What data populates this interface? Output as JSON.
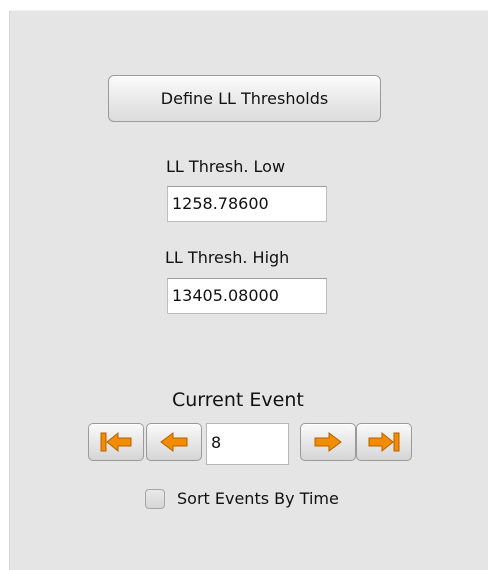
{
  "thresholds": {
    "define_button_label": "Define LL Thresholds",
    "low_label": "LL Thresh. Low",
    "low_value": "1258.78600",
    "high_label": "LL Thresh. High",
    "high_value": "13405.08000"
  },
  "event_nav": {
    "title": "Current Event",
    "current_value": "8",
    "first_icon": "first-event-icon",
    "prev_icon": "previous-event-icon",
    "next_icon": "next-event-icon",
    "last_icon": "last-event-icon",
    "icon_color": "#f28c00"
  },
  "sort": {
    "label": "Sort Events By Time",
    "checked": false
  }
}
